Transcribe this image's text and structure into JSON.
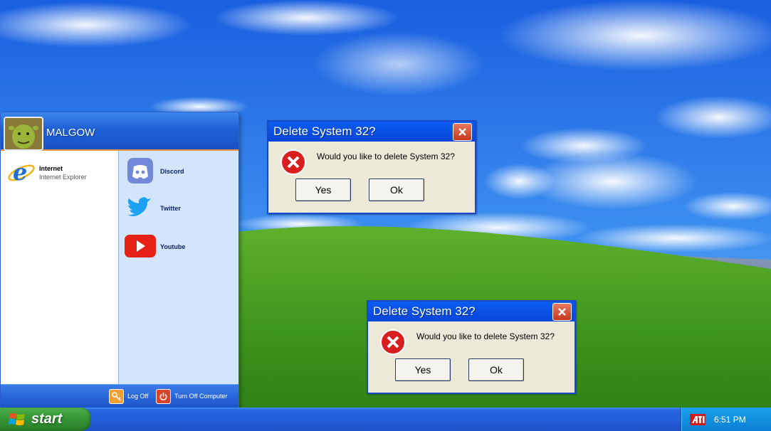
{
  "start_menu": {
    "user_name": "MALGOW",
    "pinned": {
      "title": "Internet",
      "subtitle": "Internet Explorer"
    },
    "apps": [
      {
        "label": "Discord"
      },
      {
        "label": "Twitter"
      },
      {
        "label": "Youtube"
      }
    ],
    "footer": {
      "log_off": "Log Off",
      "turn_off": "Turn Off Computer"
    }
  },
  "dialogs": [
    {
      "title": "Delete System 32?",
      "message": "Would you like to delete System 32?",
      "yes_label": "Yes",
      "ok_label": "Ok"
    },
    {
      "title": "Delete System 32?",
      "message": "Would you like to delete System 32?",
      "yes_label": "Yes",
      "ok_label": "Ok"
    }
  ],
  "taskbar": {
    "start_label": "start",
    "clock": "6:51 PM"
  },
  "colors": {
    "title_blue": "#0a5cf0",
    "start_green": "#3b9e3a",
    "close_red": "#c5371c",
    "tray_blue": "#1290e0",
    "discord": "#7289da",
    "twitter": "#1da1f2",
    "youtube": "#e62117"
  }
}
